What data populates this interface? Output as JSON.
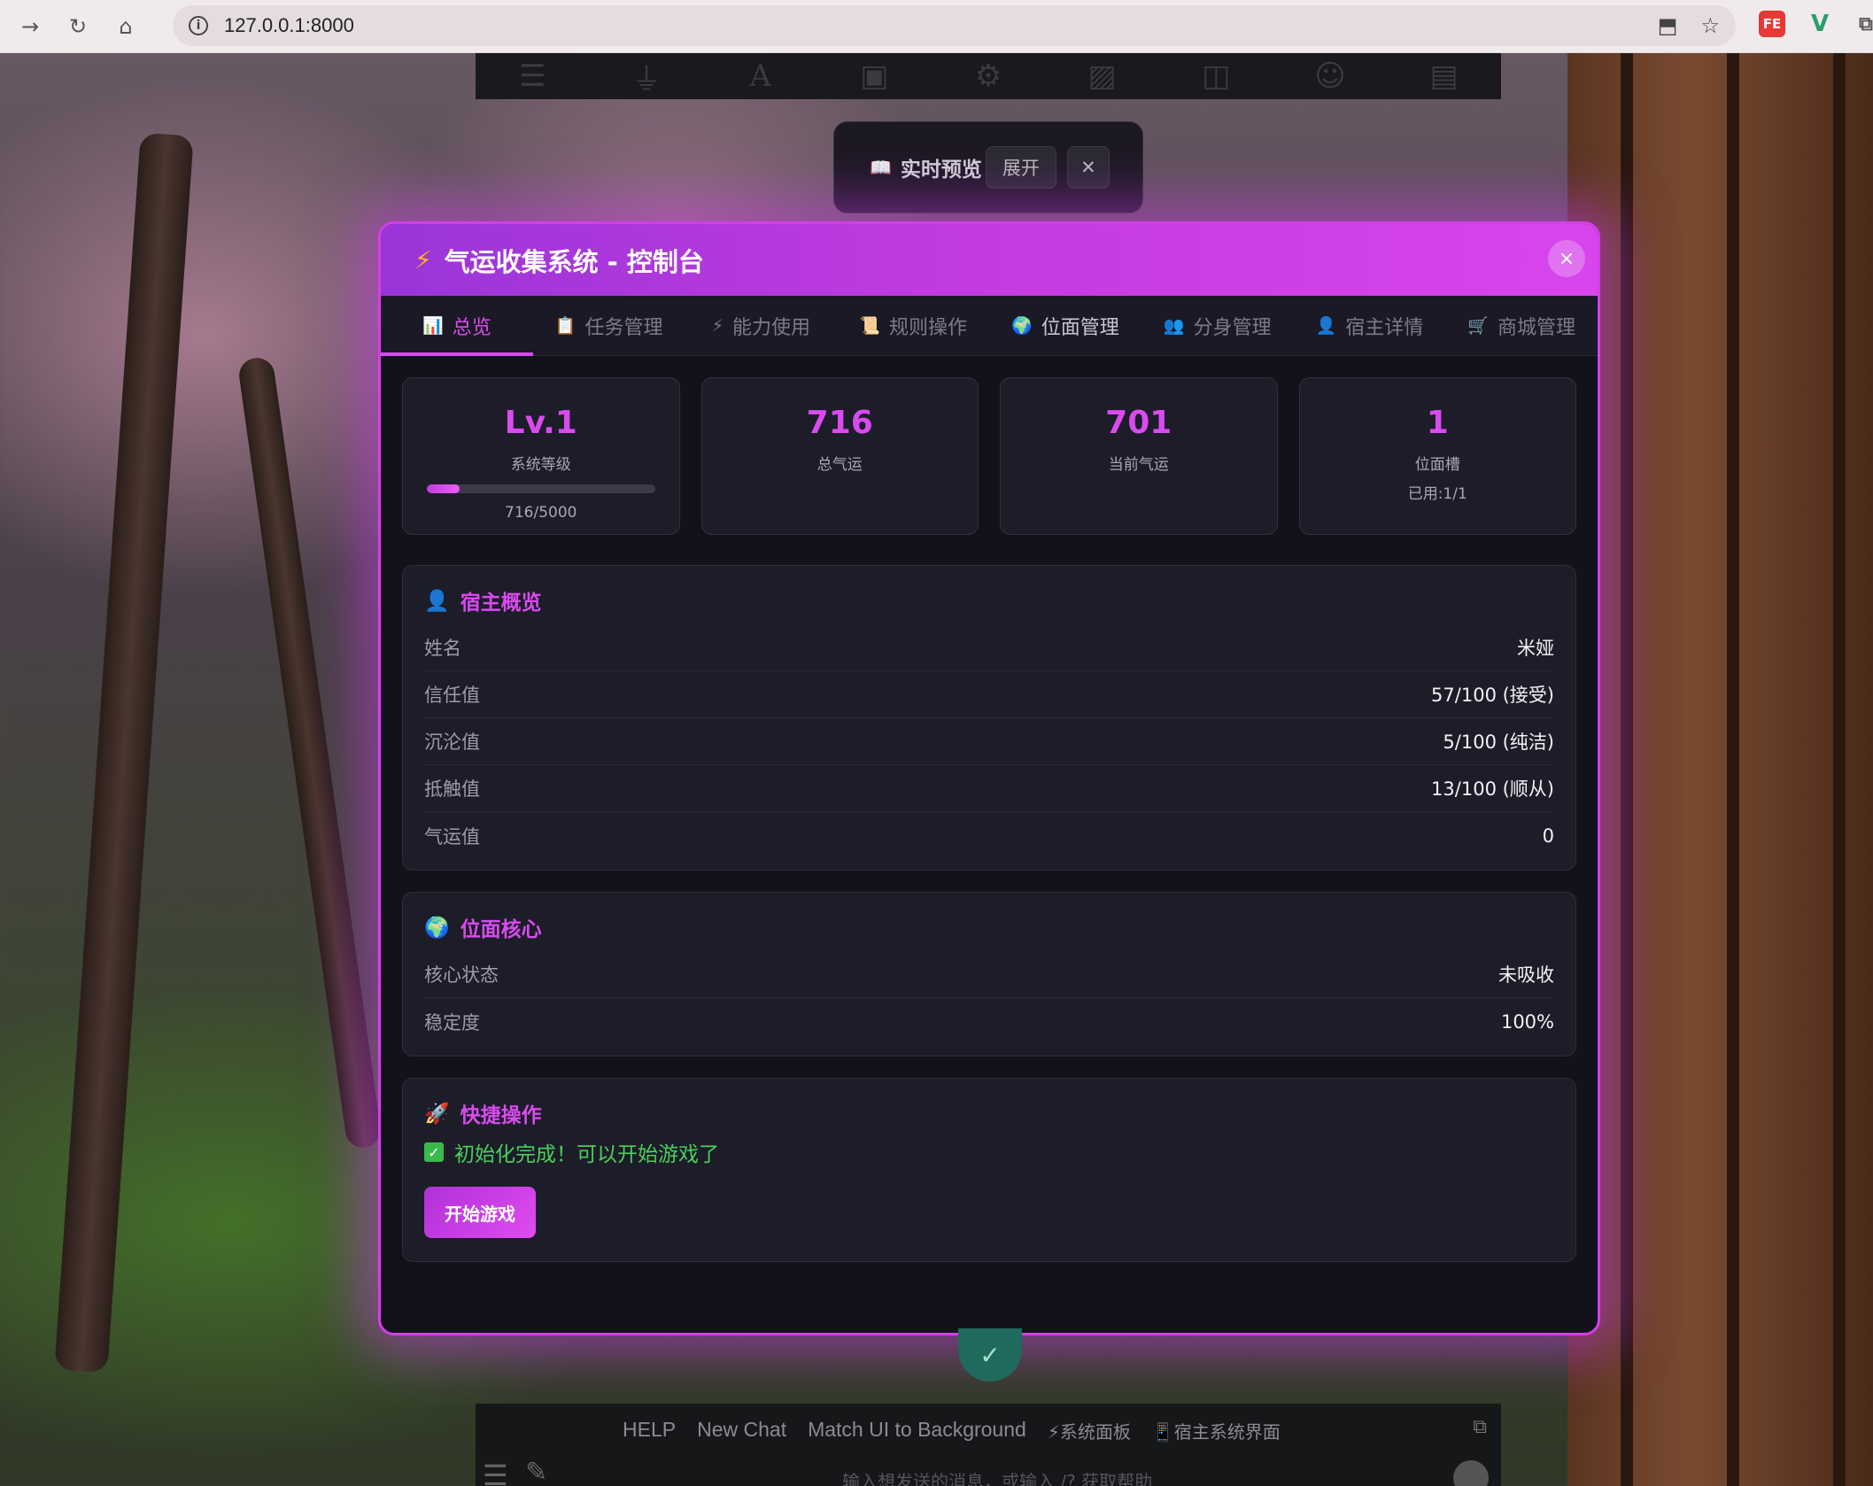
{
  "browser": {
    "url": "127.0.0.1:8000"
  },
  "preview": {
    "title": "实时预览",
    "expand_label": "展开",
    "close_label": "✕"
  },
  "modal": {
    "title": "气运收集系统 - 控制台",
    "close_label": "×",
    "tabs": [
      {
        "icon": "📊",
        "label": "总览"
      },
      {
        "icon": "📋",
        "label": "任务管理"
      },
      {
        "icon": "⚡",
        "label": "能力使用"
      },
      {
        "icon": "📜",
        "label": "规则操作"
      },
      {
        "icon": "🌍",
        "label": "位面管理"
      },
      {
        "icon": "👥",
        "label": "分身管理"
      },
      {
        "icon": "👤",
        "label": "宿主详情"
      },
      {
        "icon": "🛒",
        "label": "商城管理"
      }
    ],
    "active_tab": "总览"
  },
  "stats": {
    "level": {
      "value": "Lv.1",
      "label": "系统等级",
      "progress_text": "716/5000",
      "progress_fraction": 0.143
    },
    "total_luck": {
      "value": "716",
      "label": "总气运"
    },
    "current_luck": {
      "value": "701",
      "label": "当前气运"
    },
    "plane_slot": {
      "value": "1",
      "label": "位面槽",
      "sub": "已用:1/1"
    }
  },
  "host_overview": {
    "title": "宿主概览",
    "icon": "👤",
    "rows": [
      {
        "key": "姓名",
        "value": "米娅"
      },
      {
        "key": "信任值",
        "value": "57/100 (接受)"
      },
      {
        "key": "沉沦值",
        "value": "5/100 (纯洁)"
      },
      {
        "key": "抵触值",
        "value": "13/100 (顺从)"
      },
      {
        "key": "气运值",
        "value": "0"
      }
    ]
  },
  "plane_core": {
    "title": "位面核心",
    "icon": "🌍",
    "rows": [
      {
        "key": "核心状态",
        "value": "未吸收"
      },
      {
        "key": "稳定度",
        "value": "100%"
      }
    ]
  },
  "quick_actions": {
    "title": "快捷操作",
    "icon": "🚀",
    "status": "初始化完成！可以开始游戏了",
    "start_button": "开始游戏"
  },
  "bottom_bar": {
    "links": [
      "HELP",
      "New Chat",
      "Match UI to Background",
      "⚡系统面板",
      "📱宿主系统界面"
    ],
    "input_placeholder": "输入想发送的消息，或输入 /? 获取帮助"
  },
  "colors": {
    "accent": "#d84bee",
    "success": "#4bcf5a",
    "panel_bg": "#1d1c29"
  }
}
